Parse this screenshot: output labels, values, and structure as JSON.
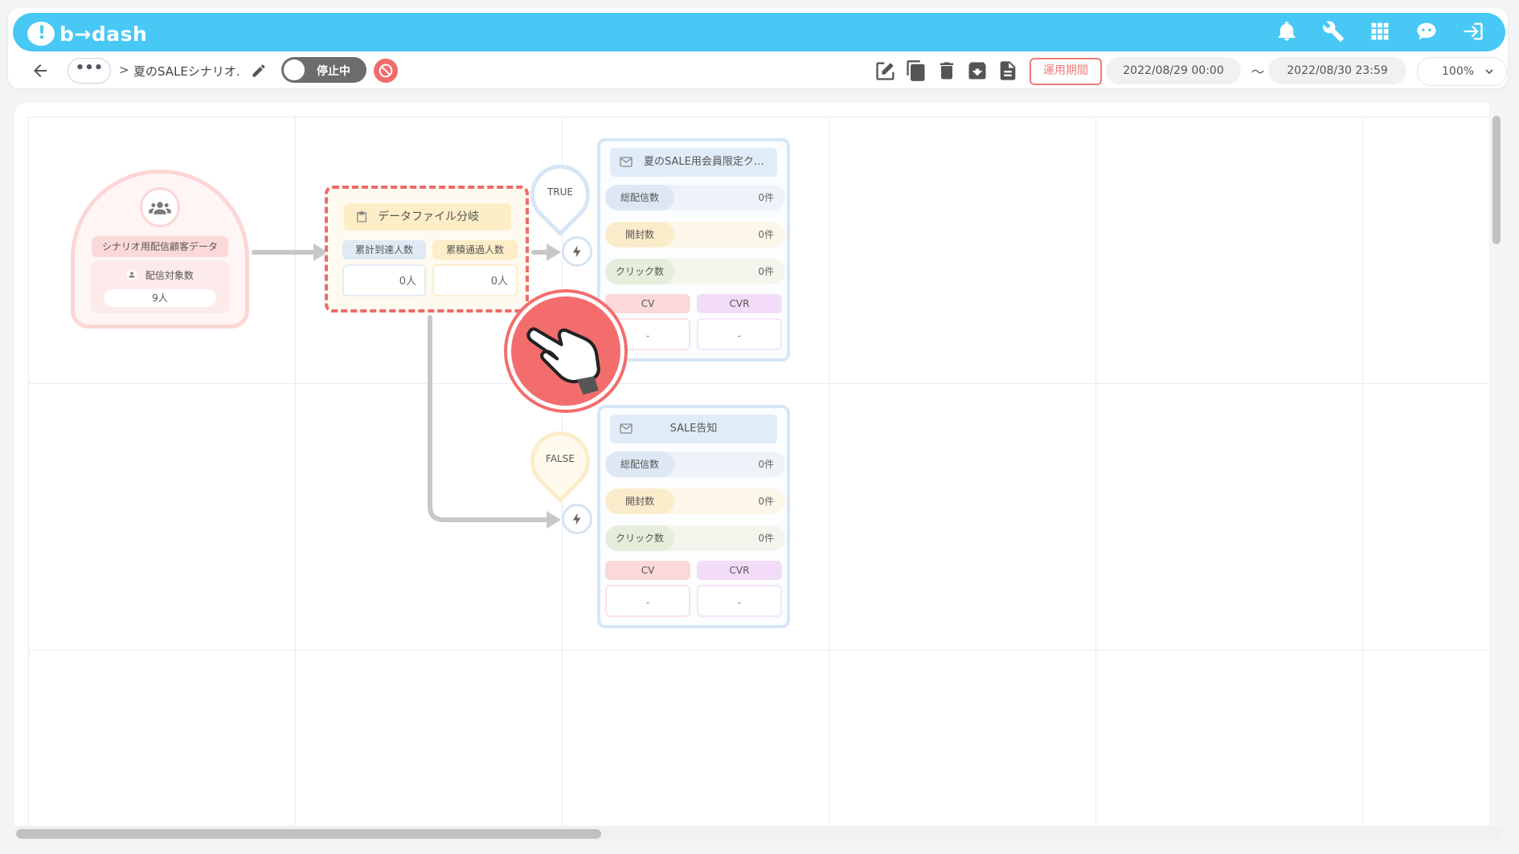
{
  "app": {
    "logo_text": "b→dash"
  },
  "topbar": {
    "icons": [
      "bell-icon",
      "wrench-icon",
      "apps-grid-icon",
      "chat-bot-icon",
      "logout-icon"
    ]
  },
  "toolbar": {
    "more_label": "•••",
    "breadcrumb_sep": ">",
    "scenario_title": "夏のSALEシナリオ.",
    "status_toggle": "停止中",
    "action_icons": [
      "edit-icon",
      "copy-icon",
      "delete-icon",
      "archive-icon",
      "document-icon"
    ],
    "period_label": "運用期間",
    "start_date": "2022/08/29 00:00",
    "range_sep": "〜",
    "end_date": "2022/08/30 23:59",
    "zoom": "100%"
  },
  "flow": {
    "start": {
      "label": "シナリオ用配信顧客データ",
      "metric_label": "配信対象数",
      "metric_value": "9人"
    },
    "branch": {
      "title": "データファイル分岐",
      "col1_label": "累計到達人数",
      "col2_label": "累積通過人数",
      "col1_value": "0人",
      "col2_value": "0人"
    },
    "true_label": "TRUE",
    "false_label": "FALSE",
    "mail_true": {
      "title": "夏のSALE用会員限定ク…",
      "sent_label": "総配信数",
      "sent_value": "0件",
      "open_label": "開封数",
      "open_value": "0件",
      "click_label": "クリック数",
      "click_value": "0件",
      "cv_label": "CV",
      "cvr_label": "CVR",
      "cv_value": "-",
      "cvr_value": "-"
    },
    "mail_false": {
      "title": "SALE告知",
      "sent_label": "総配信数",
      "sent_value": "0件",
      "open_label": "開封数",
      "open_value": "0件",
      "click_label": "クリック数",
      "click_value": "0件",
      "cv_label": "CV",
      "cvr_label": "CVR",
      "cv_value": "-",
      "cvr_value": "-"
    }
  },
  "colors": {
    "brand": "#47c8f5",
    "accent_red": "#ef6a6a",
    "toggle_off": "#6c6c6c"
  }
}
